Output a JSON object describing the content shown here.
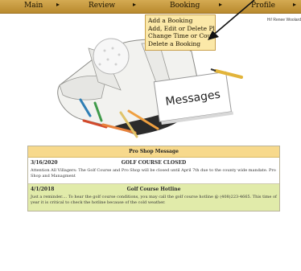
{
  "menu": {
    "items": [
      "Main",
      "Review",
      "Booking",
      "Profile"
    ],
    "arrow": "▸"
  },
  "greeting": "Hi! Renee Woolard",
  "booking_dropdown": {
    "items": [
      "Add a Booking",
      "Add, Edit or Delete Players",
      "Change Time or Course",
      "Delete a Booking"
    ]
  },
  "hero": {
    "card_text": "Messages"
  },
  "message_panel": {
    "header": "Pro Shop Message",
    "messages": [
      {
        "date": "3/16/2020",
        "title": "GOLF COURSE CLOSED",
        "body": "Attention All Villagers: The Golf Course and Pro Shop will be closed until April 7th due to the county wide mandate. Pro Shop and Managment"
      },
      {
        "date": "4/1/2018",
        "title": "Golf Course Hotline",
        "body": "Just a reminder.... To hear the golf course conditions, you may call the golf course hotline @ (408)223-4665. This time of year it is critical to check the hotline because of the cold weather."
      }
    ]
  },
  "colors": {
    "menubar": "#c89a3e",
    "dropdown": "#fbe8a8",
    "panel_header": "#f7d98c",
    "message_alt": "#e1ebaa"
  }
}
